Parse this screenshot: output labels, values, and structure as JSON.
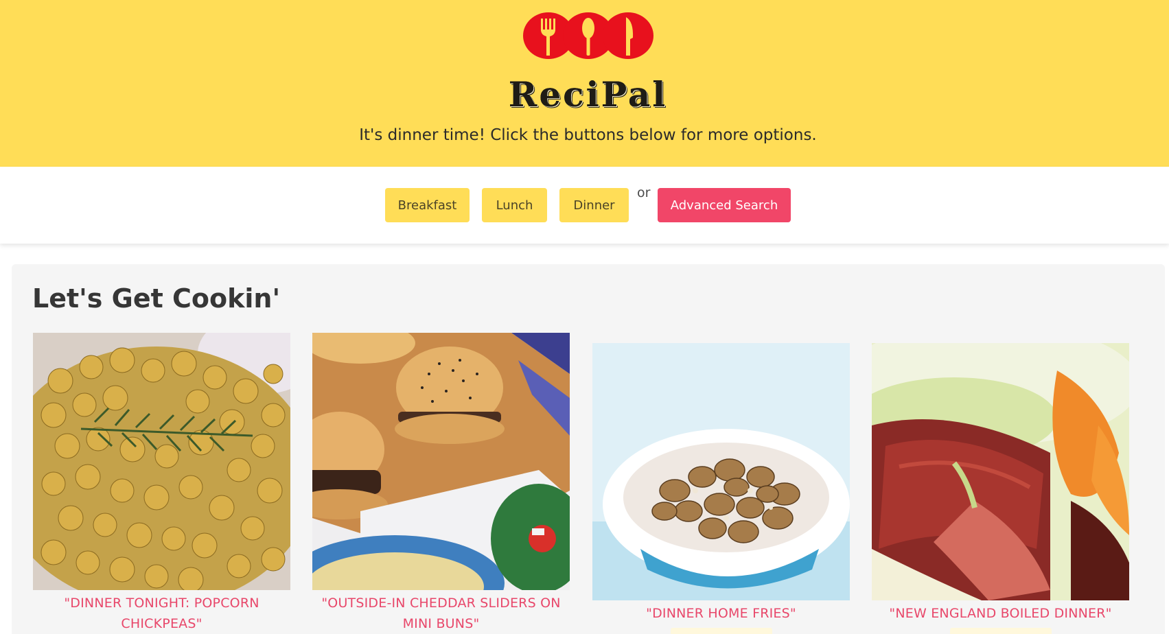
{
  "header": {
    "brand": "ReciPal",
    "tagline": "It's dinner time! Click the buttons below for more options.",
    "logo_icon": "fork-spoon-knife-icon",
    "brand_color": "#ffdd57",
    "logo_color": "#e8111d"
  },
  "nav": {
    "breakfast_label": "Breakfast",
    "lunch_label": "Lunch",
    "dinner_label": "Dinner",
    "or_label": "or",
    "advanced_label": "Advanced Search",
    "accent_color": "#f14668"
  },
  "main": {
    "title": "Let's Get Cookin'",
    "recipes": [
      {
        "title": "\"DINNER TONIGHT: POPCORN CHICKPEAS\""
      },
      {
        "title": "\"OUTSIDE-IN CHEDDAR SLIDERS ON MINI BUNS\""
      },
      {
        "title": "\"DINNER HOME FRIES\""
      },
      {
        "title": "\"NEW ENGLAND BOILED DINNER\""
      }
    ]
  }
}
